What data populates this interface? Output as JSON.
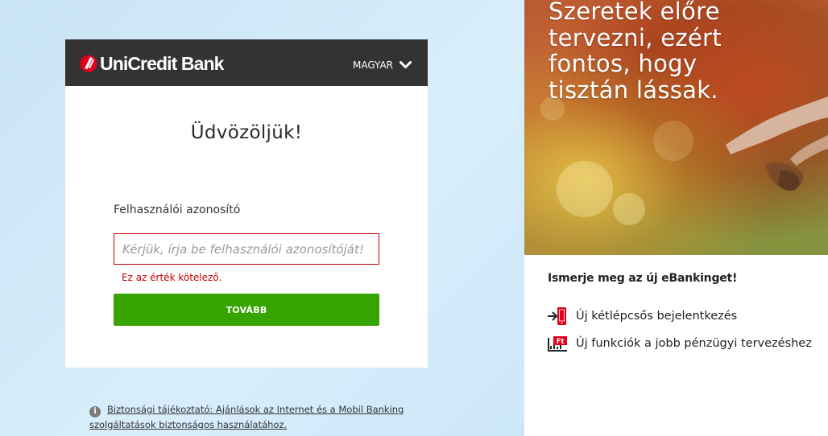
{
  "header": {
    "logo_text": "UniCredit Bank",
    "language": "MAGYAR"
  },
  "login": {
    "welcome": "Üdvözöljük!",
    "user_id_label": "Felhasználói azonosító",
    "user_id_value": "",
    "user_id_placeholder": "Kérjük, írja be felhasználói azonosítóját!",
    "error_message": "Ez az érték kötelező.",
    "submit_label": "TOVÁBB"
  },
  "security_notice": {
    "icon": "info-icon",
    "link_text": "Biztonsági tájékoztató: Ajánlások az Internet és a Mobil Banking szolgáltatások biztonságos használatához."
  },
  "promo": {
    "image_lines": [
      "Szeretek előre",
      "tervezni, ezért",
      "fontos, hogy",
      "tisztán lássak."
    ],
    "heading": "Ismerje meg az új eBankinget!",
    "features": [
      {
        "icon": "login-phone-icon",
        "label": "Új kétlépcsős bejelentkezés"
      },
      {
        "icon": "ft-chart-icon",
        "label": "Új funkciók a jobb pénzügyi tervezéshez"
      }
    ]
  },
  "colors": {
    "header_bg": "#333333",
    "accent_red": "#e2001a",
    "primary_green": "#36a401",
    "error_red": "#c40000",
    "page_bg": "#cbe6f7"
  }
}
